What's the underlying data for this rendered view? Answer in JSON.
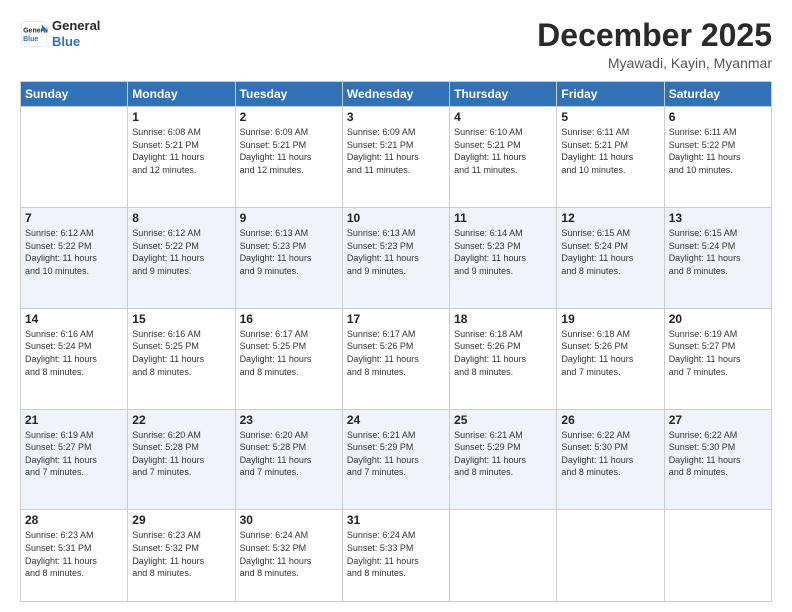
{
  "logo": {
    "line1": "General",
    "line2": "Blue"
  },
  "title": "December 2025",
  "location": "Myawadi, Kayin, Myanmar",
  "weekdays": [
    "Sunday",
    "Monday",
    "Tuesday",
    "Wednesday",
    "Thursday",
    "Friday",
    "Saturday"
  ],
  "weeks": [
    [
      {
        "day": "",
        "info": ""
      },
      {
        "day": "1",
        "info": "Sunrise: 6:08 AM\nSunset: 5:21 PM\nDaylight: 11 hours\nand 12 minutes."
      },
      {
        "day": "2",
        "info": "Sunrise: 6:09 AM\nSunset: 5:21 PM\nDaylight: 11 hours\nand 12 minutes."
      },
      {
        "day": "3",
        "info": "Sunrise: 6:09 AM\nSunset: 5:21 PM\nDaylight: 11 hours\nand 11 minutes."
      },
      {
        "day": "4",
        "info": "Sunrise: 6:10 AM\nSunset: 5:21 PM\nDaylight: 11 hours\nand 11 minutes."
      },
      {
        "day": "5",
        "info": "Sunrise: 6:11 AM\nSunset: 5:21 PM\nDaylight: 11 hours\nand 10 minutes."
      },
      {
        "day": "6",
        "info": "Sunrise: 6:11 AM\nSunset: 5:22 PM\nDaylight: 11 hours\nand 10 minutes."
      }
    ],
    [
      {
        "day": "7",
        "info": "Sunrise: 6:12 AM\nSunset: 5:22 PM\nDaylight: 11 hours\nand 10 minutes."
      },
      {
        "day": "8",
        "info": "Sunrise: 6:12 AM\nSunset: 5:22 PM\nDaylight: 11 hours\nand 9 minutes."
      },
      {
        "day": "9",
        "info": "Sunrise: 6:13 AM\nSunset: 5:23 PM\nDaylight: 11 hours\nand 9 minutes."
      },
      {
        "day": "10",
        "info": "Sunrise: 6:13 AM\nSunset: 5:23 PM\nDaylight: 11 hours\nand 9 minutes."
      },
      {
        "day": "11",
        "info": "Sunrise: 6:14 AM\nSunset: 5:23 PM\nDaylight: 11 hours\nand 9 minutes."
      },
      {
        "day": "12",
        "info": "Sunrise: 6:15 AM\nSunset: 5:24 PM\nDaylight: 11 hours\nand 8 minutes."
      },
      {
        "day": "13",
        "info": "Sunrise: 6:15 AM\nSunset: 5:24 PM\nDaylight: 11 hours\nand 8 minutes."
      }
    ],
    [
      {
        "day": "14",
        "info": "Sunrise: 6:16 AM\nSunset: 5:24 PM\nDaylight: 11 hours\nand 8 minutes."
      },
      {
        "day": "15",
        "info": "Sunrise: 6:16 AM\nSunset: 5:25 PM\nDaylight: 11 hours\nand 8 minutes."
      },
      {
        "day": "16",
        "info": "Sunrise: 6:17 AM\nSunset: 5:25 PM\nDaylight: 11 hours\nand 8 minutes."
      },
      {
        "day": "17",
        "info": "Sunrise: 6:17 AM\nSunset: 5:26 PM\nDaylight: 11 hours\nand 8 minutes."
      },
      {
        "day": "18",
        "info": "Sunrise: 6:18 AM\nSunset: 5:26 PM\nDaylight: 11 hours\nand 8 minutes."
      },
      {
        "day": "19",
        "info": "Sunrise: 6:18 AM\nSunset: 5:26 PM\nDaylight: 11 hours\nand 7 minutes."
      },
      {
        "day": "20",
        "info": "Sunrise: 6:19 AM\nSunset: 5:27 PM\nDaylight: 11 hours\nand 7 minutes."
      }
    ],
    [
      {
        "day": "21",
        "info": "Sunrise: 6:19 AM\nSunset: 5:27 PM\nDaylight: 11 hours\nand 7 minutes."
      },
      {
        "day": "22",
        "info": "Sunrise: 6:20 AM\nSunset: 5:28 PM\nDaylight: 11 hours\nand 7 minutes."
      },
      {
        "day": "23",
        "info": "Sunrise: 6:20 AM\nSunset: 5:28 PM\nDaylight: 11 hours\nand 7 minutes."
      },
      {
        "day": "24",
        "info": "Sunrise: 6:21 AM\nSunset: 5:29 PM\nDaylight: 11 hours\nand 7 minutes."
      },
      {
        "day": "25",
        "info": "Sunrise: 6:21 AM\nSunset: 5:29 PM\nDaylight: 11 hours\nand 8 minutes."
      },
      {
        "day": "26",
        "info": "Sunrise: 6:22 AM\nSunset: 5:30 PM\nDaylight: 11 hours\nand 8 minutes."
      },
      {
        "day": "27",
        "info": "Sunrise: 6:22 AM\nSunset: 5:30 PM\nDaylight: 11 hours\nand 8 minutes."
      }
    ],
    [
      {
        "day": "28",
        "info": "Sunrise: 6:23 AM\nSunset: 5:31 PM\nDaylight: 11 hours\nand 8 minutes."
      },
      {
        "day": "29",
        "info": "Sunrise: 6:23 AM\nSunset: 5:32 PM\nDaylight: 11 hours\nand 8 minutes."
      },
      {
        "day": "30",
        "info": "Sunrise: 6:24 AM\nSunset: 5:32 PM\nDaylight: 11 hours\nand 8 minutes."
      },
      {
        "day": "31",
        "info": "Sunrise: 6:24 AM\nSunset: 5:33 PM\nDaylight: 11 hours\nand 8 minutes."
      },
      {
        "day": "",
        "info": ""
      },
      {
        "day": "",
        "info": ""
      },
      {
        "day": "",
        "info": ""
      }
    ]
  ]
}
